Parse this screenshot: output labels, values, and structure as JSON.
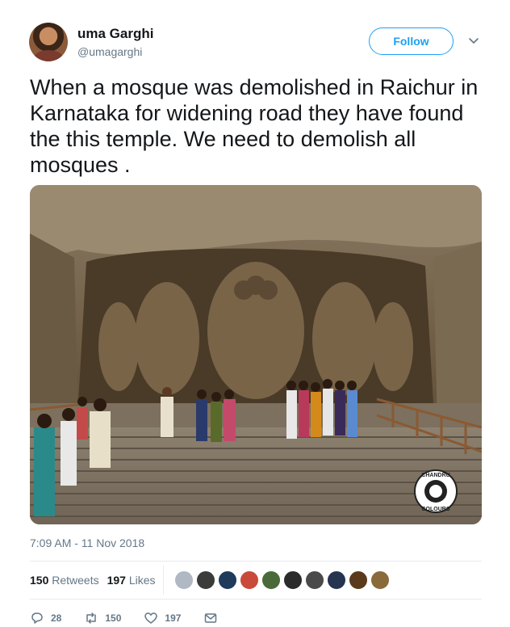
{
  "author": {
    "name": "uma Garghi",
    "handle": "@umagarghi"
  },
  "follow_label": "Follow",
  "tweet_text": "When a mosque was demolished in Raichur in Karnataka for widening road they have found the this temple. We need to demolish all mosques .",
  "photo": {
    "watermark": "CHANDRU COLOURS"
  },
  "timestamp": "7:09 AM - 11 Nov 2018",
  "stats": {
    "retweets_count": "150",
    "retweets_label": "Retweets",
    "likes_count": "197",
    "likes_label": "Likes"
  },
  "liker_colors": [
    "#b0b8c4",
    "#3b3b3b",
    "#1f3a5a",
    "#c94a3a",
    "#4a6a3a",
    "#2b2b2b",
    "#4a4a4a",
    "#273450",
    "#5a3a1a",
    "#8a6a3a"
  ],
  "actions": {
    "reply_count": "28",
    "retweet_count": "150",
    "like_count": "197"
  },
  "colors": {
    "accent": "#1da1f2",
    "secondary_text": "#657786",
    "primary_text": "#14171a"
  }
}
